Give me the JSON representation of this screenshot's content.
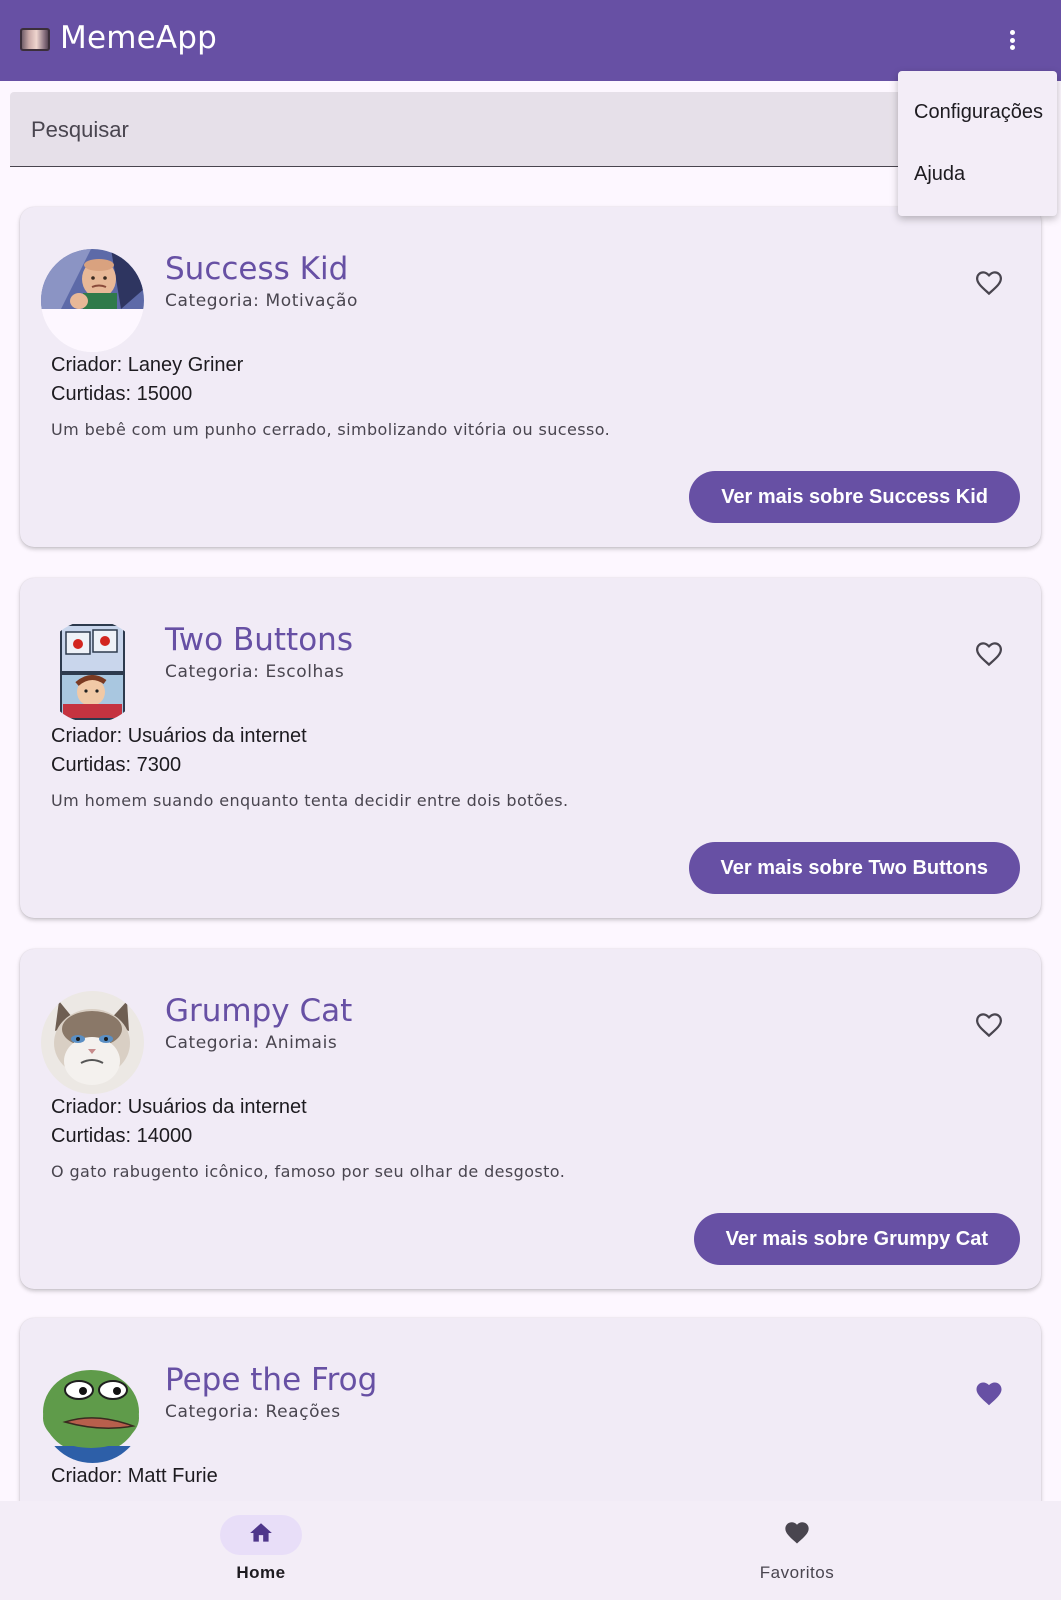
{
  "app_bar": {
    "title": "MemeApp",
    "background": "#6750a4",
    "overflow_icon": "more-vert-icon"
  },
  "search": {
    "placeholder": "Pesquisar"
  },
  "overflow_menu": {
    "items": [
      {
        "label": "Configurações"
      },
      {
        "label": "Ajuda"
      }
    ]
  },
  "memes": [
    {
      "title": "Success Kid",
      "category": "Categoria: Motivação",
      "creator": "Criador: Laney Griner",
      "likes": "Curtidas: 15000",
      "description": "Um bebê com um punho cerrado, simbolizando vitória ou sucesso.",
      "button": "Ver mais sobre Success Kid",
      "favorited": false,
      "favorite_icon": "heart-outline-icon"
    },
    {
      "title": "Two Buttons",
      "category": "Categoria: Escolhas",
      "creator": "Criador: Usuários da internet",
      "likes": "Curtidas: 7300",
      "description": "Um homem suando enquanto tenta decidir entre dois botões.",
      "button": "Ver mais sobre Two Buttons",
      "favorited": false,
      "favorite_icon": "heart-outline-icon"
    },
    {
      "title": "Grumpy Cat",
      "category": "Categoria: Animais",
      "creator": "Criador: Usuários da internet",
      "likes": "Curtidas: 14000",
      "description": "O gato rabugento icônico, famoso por seu olhar de desgosto.",
      "button": "Ver mais sobre Grumpy Cat",
      "favorited": false,
      "favorite_icon": "heart-outline-icon"
    },
    {
      "title": "Pepe the Frog",
      "category": "Categoria: Reações",
      "creator": "Criador: Matt Furie",
      "favorited": true,
      "favorite_icon": "heart-filled-icon"
    }
  ],
  "bottom_nav": {
    "items": [
      {
        "label": "Home",
        "icon": "home-icon",
        "selected": true
      },
      {
        "label": "Favoritos",
        "icon": "heart-filled-icon",
        "selected": false
      }
    ]
  },
  "colors": {
    "primary": "#6750a4",
    "card_background": "#f1ebf6",
    "nav_indicator": "#e8def8"
  }
}
